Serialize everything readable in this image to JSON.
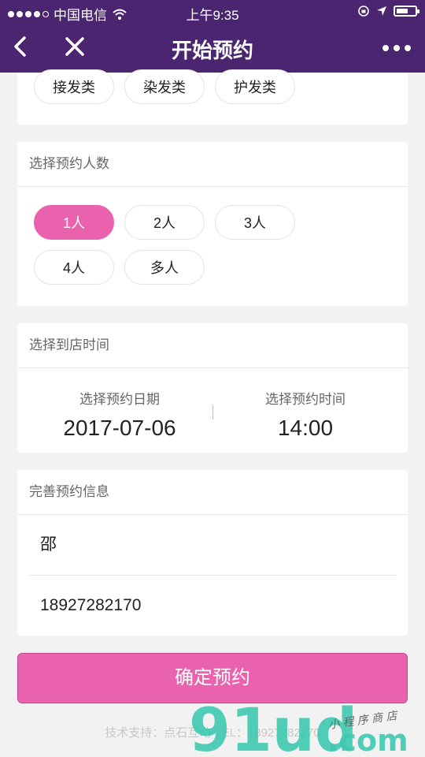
{
  "status_bar": {
    "carrier": "中国电信",
    "time": "上午9:35"
  },
  "nav": {
    "title": "开始预约"
  },
  "category_section": {
    "options": [
      "接发类",
      "染发类",
      "护发类"
    ]
  },
  "people_section": {
    "title": "选择预约人数",
    "options": [
      "1人",
      "2人",
      "3人",
      "4人",
      "多人"
    ],
    "selected": "1人"
  },
  "time_section": {
    "title": "选择到店时间",
    "date_label": "选择预约日期",
    "date_value": "2017-07-06",
    "time_label": "选择预约时间",
    "time_value": "14:00"
  },
  "info_section": {
    "title": "完善预约信息",
    "name_value": "邵",
    "phone_value": "18927282170"
  },
  "confirm_button": {
    "label": "确定预约"
  },
  "footer": {
    "text": "技术支持：点石互动 TEL：18927282170"
  },
  "watermark": {
    "text": "91ud.com",
    "tagline": "小程序商店"
  },
  "colors": {
    "nav_bg": "#4b2570",
    "accent": "#ea62ad",
    "page_bg": "#f2f2f2"
  }
}
